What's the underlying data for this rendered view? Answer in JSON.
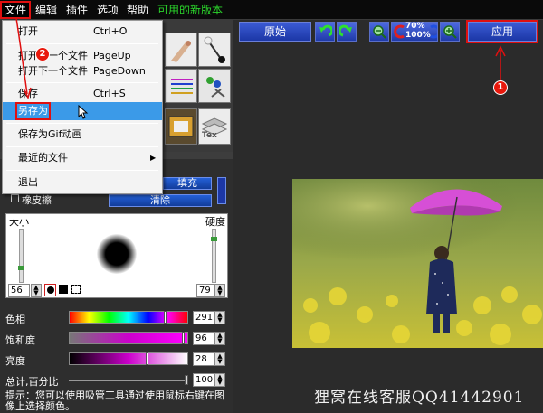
{
  "menubar": {
    "items": [
      {
        "label": "文件"
      },
      {
        "label": "编辑"
      },
      {
        "label": "插件"
      },
      {
        "label": "选项"
      },
      {
        "label": "帮助"
      },
      {
        "label": "可用的新版本"
      }
    ]
  },
  "file_menu": {
    "items": [
      {
        "label": "打开",
        "shortcut": "Ctrl+O"
      },
      {
        "label": "打开上一个文件",
        "shortcut": "PageUp"
      },
      {
        "label": "打开下一个文件",
        "shortcut": "PageDown"
      },
      {
        "label": "保存",
        "shortcut": "Ctrl+S"
      },
      {
        "label": "另存为",
        "shortcut": ""
      },
      {
        "label": "保存为Gif动画",
        "shortcut": ""
      },
      {
        "label": "最近的文件",
        "shortcut": ""
      },
      {
        "label": "退出",
        "shortcut": ""
      }
    ],
    "submenu_arrow": "▶"
  },
  "toolbar": {
    "original_label": "原始",
    "zoom_top": "70%",
    "zoom_bottom": "100%",
    "apply_label": "应用",
    "icons": [
      "undo-icon",
      "redo-icon",
      "zoom-out-icon",
      "zoom-reset-icon",
      "zoom-in-icon"
    ]
  },
  "tool_tiles": [
    "tex-icon"
  ],
  "brush": {
    "fill_label": "填充",
    "eraser_label": "橡皮擦",
    "clear_label": "清除",
    "size_label": "大小",
    "hardness_label": "硬度",
    "size_value": "56",
    "hardness_value": "79",
    "hue_label": "色相",
    "hue_value": "291",
    "saturation_label": "饱和度",
    "saturation_value": "96",
    "brightness_label": "亮度",
    "brightness_value": "28",
    "opacity_label": "总计,百分比",
    "opacity_value": "100",
    "hint": "提示：您可以使用吸管工具通过使用鼠标右键在图像上选择颜色。"
  },
  "annotations": {
    "badge_1": "1",
    "badge_2": "2"
  },
  "watermark": "狸窝在线客服QQ41442901",
  "colors": {
    "accent_red": "#e01010",
    "button_blue": "#1c37a6",
    "highlight_blue": "#3b9ae8",
    "promo_green": "#2bd42b"
  }
}
